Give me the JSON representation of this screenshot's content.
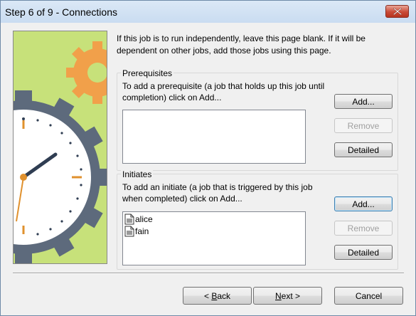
{
  "window": {
    "title": "Step 6 of 9 - Connections"
  },
  "intro_text": "If this job is to run independently, leave this page blank. If it will be dependent on other jobs, add those jobs using this page.",
  "prerequisites": {
    "legend": "Prerequisites",
    "description": "To add a prerequisite (a job that holds up this job until completion) click on Add...",
    "items": [],
    "add_label": "Add...",
    "remove_label": "Remove",
    "detailed_label": "Detailed"
  },
  "initiates": {
    "legend": "Initiates",
    "description": "To add an initiate (a job that is triggered by this job when completed) click on Add...",
    "items": [
      {
        "label": "alice",
        "icon": "document-icon"
      },
      {
        "label": "fain",
        "icon": "document-icon"
      }
    ],
    "add_label": "Add...",
    "remove_label": "Remove",
    "detailed_label": "Detailed"
  },
  "footer": {
    "back_prefix": "< ",
    "back_mnemonic": "B",
    "back_rest": "ack",
    "next_mnemonic": "N",
    "next_rest": "ext >",
    "cancel_label": "Cancel"
  },
  "colors": {
    "illustration_bg": "#c7e17a",
    "gear_dark": "#5d6a7c",
    "gear_orange": "#f1a04a",
    "clock_face": "#ffffff",
    "clock_hands": "#2f3d52",
    "second_hand": "#e0912e"
  }
}
